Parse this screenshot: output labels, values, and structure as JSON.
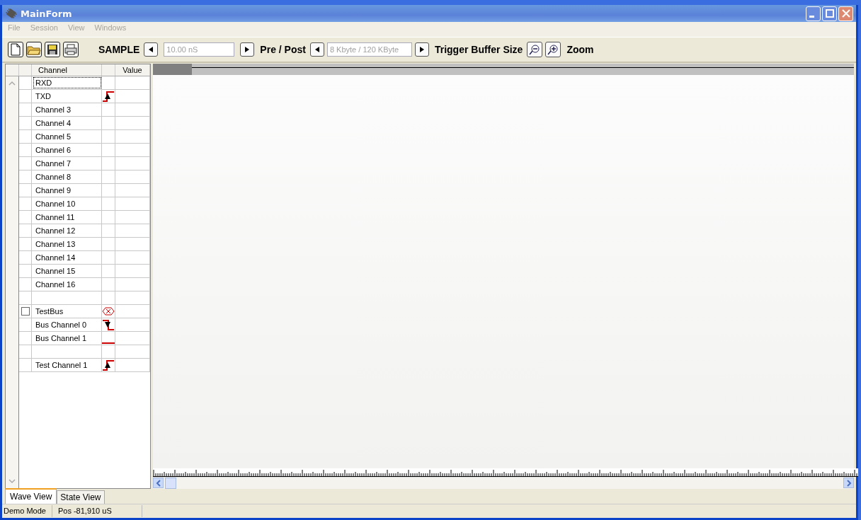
{
  "window": {
    "title": "MainForm"
  },
  "menu": [
    {
      "label": "File",
      "disabled": true
    },
    {
      "label": "Session",
      "disabled": true
    },
    {
      "label": "View",
      "disabled": true
    },
    {
      "label": "Windows",
      "disabled": true
    }
  ],
  "toolbar": {
    "sample_label": "SAMPLE",
    "sample_value": "10.00 nS",
    "prepost_label": "Pre / Post",
    "prepost_value": "8 Kbyte / 120 KByte",
    "trigger_label": "Trigger Buffer Size",
    "zoom_label": "Zoom"
  },
  "grid": {
    "columns": [
      "Channel",
      "Value"
    ],
    "rows": [
      {
        "kind": "plain",
        "name": "RXD",
        "selected": true
      },
      {
        "kind": "rising",
        "name": "TXD",
        "selected": false
      },
      {
        "kind": "plain",
        "name": "Channel 3",
        "selected": false
      },
      {
        "kind": "plain",
        "name": "Channel 4",
        "selected": false
      },
      {
        "kind": "plain",
        "name": "Channel 5",
        "selected": false
      },
      {
        "kind": "plain",
        "name": "Channel 6",
        "selected": false
      },
      {
        "kind": "plain",
        "name": "Channel 7",
        "selected": false
      },
      {
        "kind": "plain",
        "name": "Channel 8",
        "selected": false
      },
      {
        "kind": "plain",
        "name": "Channel 9",
        "selected": false
      },
      {
        "kind": "plain",
        "name": "Channel 10",
        "selected": false
      },
      {
        "kind": "plain",
        "name": "Channel 11",
        "selected": false
      },
      {
        "kind": "plain",
        "name": "Channel 12",
        "selected": false
      },
      {
        "kind": "plain",
        "name": "Channel 13",
        "selected": false
      },
      {
        "kind": "plain",
        "name": "Channel 14",
        "selected": false
      },
      {
        "kind": "plain",
        "name": "Channel 15",
        "selected": false
      },
      {
        "kind": "plain",
        "name": "Channel 16",
        "selected": false
      },
      {
        "kind": "blank"
      },
      {
        "kind": "bus",
        "name": "TestBus",
        "checked": false,
        "selected": false
      },
      {
        "kind": "falling",
        "name": "Bus Channel 0",
        "selected": false
      },
      {
        "kind": "low",
        "name": "Bus Channel 1",
        "selected": false
      },
      {
        "kind": "blank"
      },
      {
        "kind": "rising",
        "name": "Test Channel 1",
        "selected": false
      }
    ]
  },
  "tabs": [
    {
      "label": "Wave View",
      "selected": true
    },
    {
      "label": "State View",
      "selected": false
    }
  ],
  "status_bar": [
    "Demo Mode",
    "Pos -81,910 uS"
  ]
}
